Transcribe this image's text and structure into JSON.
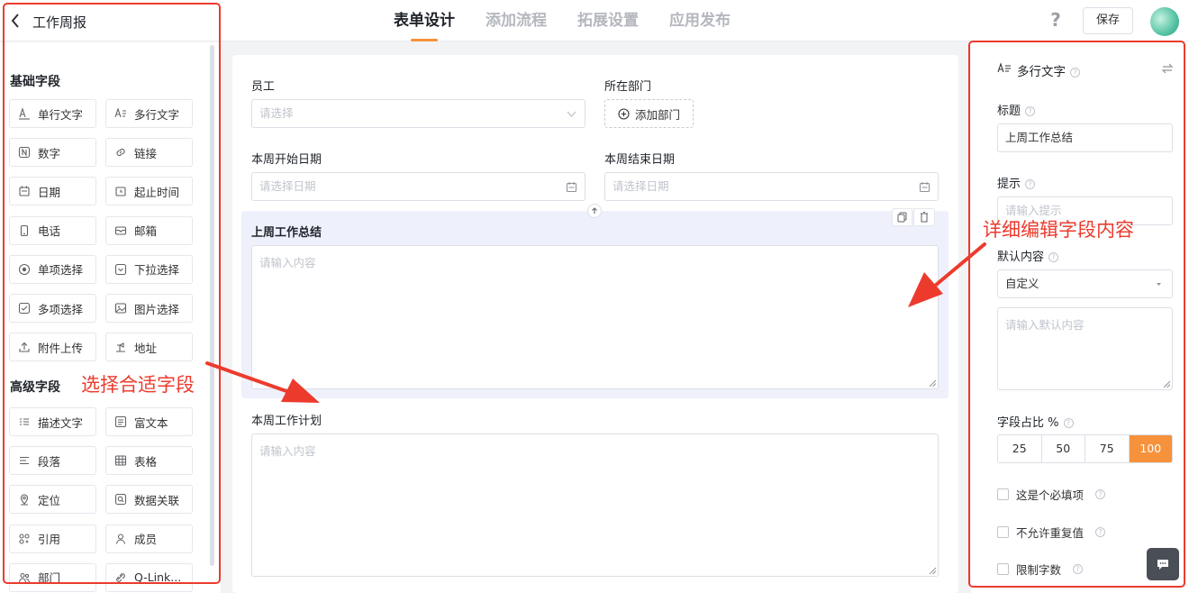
{
  "header": {
    "back_title": "工作周报",
    "tabs": [
      "表单设计",
      "添加流程",
      "拓展设置",
      "应用发布"
    ],
    "help": "?",
    "save_label": "保存"
  },
  "sidebar": {
    "basic_title": "基础字段",
    "basic_fields": [
      {
        "label": "单行文字",
        "icon": "single-line-text-icon"
      },
      {
        "label": "多行文字",
        "icon": "multi-line-text-icon"
      },
      {
        "label": "数字",
        "icon": "number-icon"
      },
      {
        "label": "链接",
        "icon": "link-icon"
      },
      {
        "label": "日期",
        "icon": "calendar-icon"
      },
      {
        "label": "起止时间",
        "icon": "time-range-icon"
      },
      {
        "label": "电话",
        "icon": "phone-icon"
      },
      {
        "label": "邮箱",
        "icon": "mail-icon"
      },
      {
        "label": "单项选择",
        "icon": "radio-icon"
      },
      {
        "label": "下拉选择",
        "icon": "dropdown-icon"
      },
      {
        "label": "多项选择",
        "icon": "checkbox-icon"
      },
      {
        "label": "图片选择",
        "icon": "image-icon"
      },
      {
        "label": "附件上传",
        "icon": "upload-icon"
      },
      {
        "label": "地址",
        "icon": "location-pin-icon"
      }
    ],
    "advanced_title": "高级字段",
    "advanced_fields": [
      {
        "label": "描述文字",
        "icon": "description-icon"
      },
      {
        "label": "富文本",
        "icon": "rich-text-icon"
      },
      {
        "label": "段落",
        "icon": "paragraph-icon"
      },
      {
        "label": "表格",
        "icon": "table-icon"
      },
      {
        "label": "定位",
        "icon": "locate-icon"
      },
      {
        "label": "数据关联",
        "icon": "data-link-icon"
      },
      {
        "label": "引用",
        "icon": "reference-icon"
      },
      {
        "label": "成员",
        "icon": "member-icon"
      },
      {
        "label": "部门",
        "icon": "department-icon"
      },
      {
        "label": "Q-Link...",
        "icon": "q-link-icon"
      }
    ]
  },
  "form": {
    "employee_label": "员工",
    "employee_placeholder": "请选择",
    "department_label": "所在部门",
    "add_department": "添加部门",
    "start_label": "本周开始日期",
    "start_placeholder": "请选择日期",
    "end_label": "本周结束日期",
    "end_placeholder": "请选择日期",
    "summary_label": "上周工作总结",
    "summary_placeholder": "请输入内容",
    "plan_label": "本周工作计划",
    "plan_placeholder": "请输入内容"
  },
  "props": {
    "type_title": "多行文字",
    "title_label": "标题",
    "title_value": "上周工作总结",
    "hint_label": "提示",
    "hint_placeholder": "请输入提示",
    "default_label": "默认内容",
    "default_select": "自定义",
    "default_placeholder": "请输入默认内容",
    "width_label": "字段占比 %",
    "width_options": [
      "25",
      "50",
      "75",
      "100"
    ],
    "width_selected": "100",
    "required_label": "这是个必填项",
    "no_duplicate_label": "不允许重复值",
    "limit_chars_label": "限制字数"
  },
  "annotations": {
    "left_note": "选择合适字段",
    "right_note": "详细编辑字段内容",
    "color": "#ec3b2d"
  },
  "colors": {
    "accent": "#f6923b",
    "selected_block_bg": "#eef1fb"
  }
}
